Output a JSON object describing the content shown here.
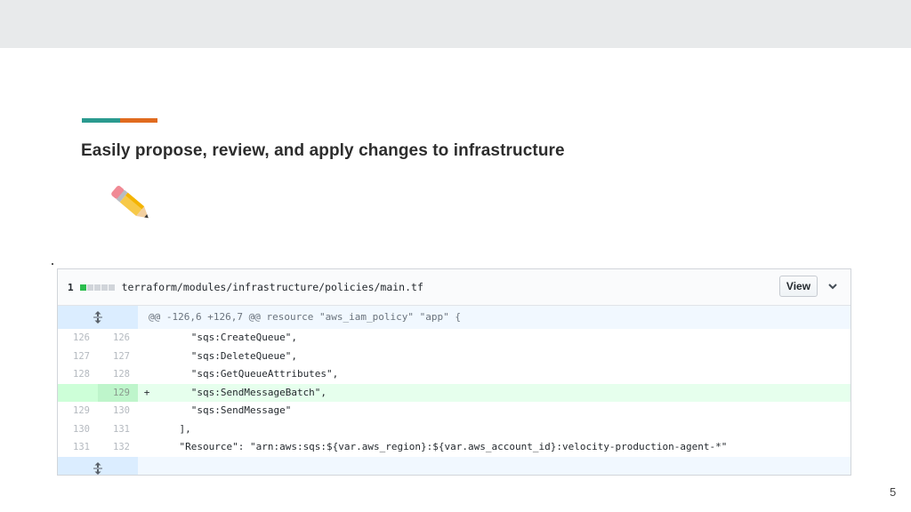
{
  "slide": {
    "title": "Easily propose, review, and apply changes to infrastructure",
    "page_number": "5",
    "accent_colors": [
      "#2a9a8f",
      "#e06b1f"
    ]
  },
  "diff": {
    "file_count": "1",
    "file_path": "terraform/modules/infrastructure/policies/main.tf",
    "view_label": "View",
    "hunk_header": "@@ -126,6 +126,7 @@ resource \"aws_iam_policy\" \"app\" {",
    "lines": [
      {
        "old": "126",
        "new": "126",
        "sign": "",
        "code": "      \"sqs:CreateQueue\","
      },
      {
        "old": "127",
        "new": "127",
        "sign": "",
        "code": "      \"sqs:DeleteQueue\","
      },
      {
        "old": "128",
        "new": "128",
        "sign": "",
        "code": "      \"sqs:GetQueueAttributes\","
      },
      {
        "old": "",
        "new": "129",
        "sign": "+",
        "code": "      \"sqs:SendMessageBatch\","
      },
      {
        "old": "129",
        "new": "130",
        "sign": "",
        "code": "      \"sqs:SendMessage\""
      },
      {
        "old": "130",
        "new": "131",
        "sign": "",
        "code": "    ],"
      },
      {
        "old": "131",
        "new": "132",
        "sign": "",
        "code": "    \"Resource\": \"arn:aws:sqs:${var.aws_region}:${var.aws_account_id}:velocity-production-agent-*\""
      }
    ],
    "colors": {
      "added_bg": "#e6ffed",
      "hunk_bg": "#f1f8ff",
      "add_block": "#2cbe4e"
    }
  }
}
